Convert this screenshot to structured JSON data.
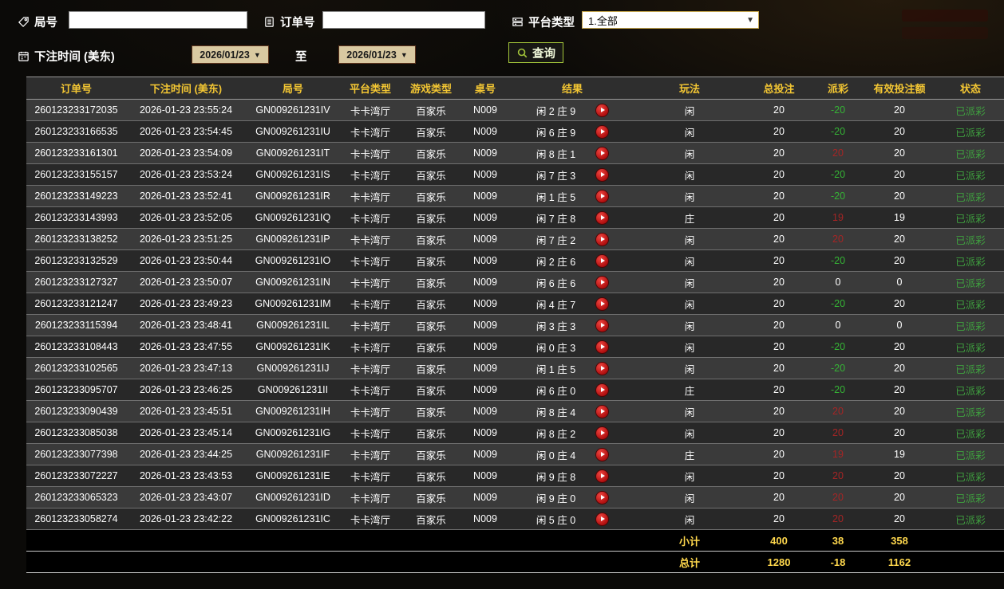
{
  "filters": {
    "round_label": "局号",
    "order_label": "订单号",
    "platform_label": "平台类型",
    "platform_value": "1.全部",
    "bet_time_label": "下注时间 (美东)",
    "date_from": "2026/01/23",
    "date_to": "2026/01/23",
    "to_label": "至",
    "query_label": "查询",
    "round_value": "",
    "order_value": ""
  },
  "icons": {
    "round": "tag-icon",
    "order": "clipboard-icon",
    "platform": "list-icon",
    "bet_time": "calendar-icon",
    "query": "search-icon",
    "replay": "play-icon",
    "dropdown": "chevron-down-icon"
  },
  "colors": {
    "header_yellow": "#f3c633",
    "summary_yellow": "#ffd84d",
    "win_red": "#a52525",
    "loss_green": "#35b435",
    "status_green": "#3fa03f",
    "query_border_green": "#a3c53a",
    "date_button_tan": "#d9c9a1"
  },
  "table": {
    "headers": [
      "订单号",
      "下注时间 (美东)",
      "局号",
      "平台类型",
      "游戏类型",
      "桌号",
      "结果",
      "玩法",
      "总投注",
      "派彩",
      "有效投注额",
      "状态"
    ],
    "rows": [
      {
        "order_id": "260123233172035",
        "bet_time": "2026-01-23 23:55:24",
        "round_id": "GN009261231IV",
        "platform": "卡卡湾厅",
        "game": "百家乐",
        "table_no": "N009",
        "result": "闲 2 庄 9",
        "play": "闲",
        "total_bet": "20",
        "payout": "-20",
        "valid_bet": "20",
        "status": "已派彩"
      },
      {
        "order_id": "260123233166535",
        "bet_time": "2026-01-23 23:54:45",
        "round_id": "GN009261231IU",
        "platform": "卡卡湾厅",
        "game": "百家乐",
        "table_no": "N009",
        "result": "闲 6 庄 9",
        "play": "闲",
        "total_bet": "20",
        "payout": "-20",
        "valid_bet": "20",
        "status": "已派彩"
      },
      {
        "order_id": "260123233161301",
        "bet_time": "2026-01-23 23:54:09",
        "round_id": "GN009261231IT",
        "platform": "卡卡湾厅",
        "game": "百家乐",
        "table_no": "N009",
        "result": "闲 8 庄 1",
        "play": "闲",
        "total_bet": "20",
        "payout": "20",
        "valid_bet": "20",
        "status": "已派彩"
      },
      {
        "order_id": "260123233155157",
        "bet_time": "2026-01-23 23:53:24",
        "round_id": "GN009261231IS",
        "platform": "卡卡湾厅",
        "game": "百家乐",
        "table_no": "N009",
        "result": "闲 7 庄 3",
        "play": "闲",
        "total_bet": "20",
        "payout": "-20",
        "valid_bet": "20",
        "status": "已派彩"
      },
      {
        "order_id": "260123233149223",
        "bet_time": "2026-01-23 23:52:41",
        "round_id": "GN009261231IR",
        "platform": "卡卡湾厅",
        "game": "百家乐",
        "table_no": "N009",
        "result": "闲 1 庄 5",
        "play": "闲",
        "total_bet": "20",
        "payout": "-20",
        "valid_bet": "20",
        "status": "已派彩"
      },
      {
        "order_id": "260123233143993",
        "bet_time": "2026-01-23 23:52:05",
        "round_id": "GN009261231IQ",
        "platform": "卡卡湾厅",
        "game": "百家乐",
        "table_no": "N009",
        "result": "闲 7 庄 8",
        "play": "庄",
        "total_bet": "20",
        "payout": "19",
        "valid_bet": "19",
        "status": "已派彩"
      },
      {
        "order_id": "260123233138252",
        "bet_time": "2026-01-23 23:51:25",
        "round_id": "GN009261231IP",
        "platform": "卡卡湾厅",
        "game": "百家乐",
        "table_no": "N009",
        "result": "闲 7 庄 2",
        "play": "闲",
        "total_bet": "20",
        "payout": "20",
        "valid_bet": "20",
        "status": "已派彩"
      },
      {
        "order_id": "260123233132529",
        "bet_time": "2026-01-23 23:50:44",
        "round_id": "GN009261231IO",
        "platform": "卡卡湾厅",
        "game": "百家乐",
        "table_no": "N009",
        "result": "闲 2 庄 6",
        "play": "闲",
        "total_bet": "20",
        "payout": "-20",
        "valid_bet": "20",
        "status": "已派彩"
      },
      {
        "order_id": "260123233127327",
        "bet_time": "2026-01-23 23:50:07",
        "round_id": "GN009261231IN",
        "platform": "卡卡湾厅",
        "game": "百家乐",
        "table_no": "N009",
        "result": "闲 6 庄 6",
        "play": "闲",
        "total_bet": "20",
        "payout": "0",
        "valid_bet": "0",
        "status": "已派彩"
      },
      {
        "order_id": "260123233121247",
        "bet_time": "2026-01-23 23:49:23",
        "round_id": "GN009261231IM",
        "platform": "卡卡湾厅",
        "game": "百家乐",
        "table_no": "N009",
        "result": "闲 4 庄 7",
        "play": "闲",
        "total_bet": "20",
        "payout": "-20",
        "valid_bet": "20",
        "status": "已派彩"
      },
      {
        "order_id": "260123233115394",
        "bet_time": "2026-01-23 23:48:41",
        "round_id": "GN009261231IL",
        "platform": "卡卡湾厅",
        "game": "百家乐",
        "table_no": "N009",
        "result": "闲 3 庄 3",
        "play": "闲",
        "total_bet": "20",
        "payout": "0",
        "valid_bet": "0",
        "status": "已派彩"
      },
      {
        "order_id": "260123233108443",
        "bet_time": "2026-01-23 23:47:55",
        "round_id": "GN009261231IK",
        "platform": "卡卡湾厅",
        "game": "百家乐",
        "table_no": "N009",
        "result": "闲 0 庄 3",
        "play": "闲",
        "total_bet": "20",
        "payout": "-20",
        "valid_bet": "20",
        "status": "已派彩"
      },
      {
        "order_id": "260123233102565",
        "bet_time": "2026-01-23 23:47:13",
        "round_id": "GN009261231IJ",
        "platform": "卡卡湾厅",
        "game": "百家乐",
        "table_no": "N009",
        "result": "闲 1 庄 5",
        "play": "闲",
        "total_bet": "20",
        "payout": "-20",
        "valid_bet": "20",
        "status": "已派彩"
      },
      {
        "order_id": "260123233095707",
        "bet_time": "2026-01-23 23:46:25",
        "round_id": "GN009261231II",
        "platform": "卡卡湾厅",
        "game": "百家乐",
        "table_no": "N009",
        "result": "闲 6 庄 0",
        "play": "庄",
        "total_bet": "20",
        "payout": "-20",
        "valid_bet": "20",
        "status": "已派彩"
      },
      {
        "order_id": "260123233090439",
        "bet_time": "2026-01-23 23:45:51",
        "round_id": "GN009261231IH",
        "platform": "卡卡湾厅",
        "game": "百家乐",
        "table_no": "N009",
        "result": "闲 8 庄 4",
        "play": "闲",
        "total_bet": "20",
        "payout": "20",
        "valid_bet": "20",
        "status": "已派彩"
      },
      {
        "order_id": "260123233085038",
        "bet_time": "2026-01-23 23:45:14",
        "round_id": "GN009261231IG",
        "platform": "卡卡湾厅",
        "game": "百家乐",
        "table_no": "N009",
        "result": "闲 8 庄 2",
        "play": "闲",
        "total_bet": "20",
        "payout": "20",
        "valid_bet": "20",
        "status": "已派彩"
      },
      {
        "order_id": "260123233077398",
        "bet_time": "2026-01-23 23:44:25",
        "round_id": "GN009261231IF",
        "platform": "卡卡湾厅",
        "game": "百家乐",
        "table_no": "N009",
        "result": "闲 0 庄 4",
        "play": "庄",
        "total_bet": "20",
        "payout": "19",
        "valid_bet": "19",
        "status": "已派彩"
      },
      {
        "order_id": "260123233072227",
        "bet_time": "2026-01-23 23:43:53",
        "round_id": "GN009261231IE",
        "platform": "卡卡湾厅",
        "game": "百家乐",
        "table_no": "N009",
        "result": "闲 9 庄 8",
        "play": "闲",
        "total_bet": "20",
        "payout": "20",
        "valid_bet": "20",
        "status": "已派彩"
      },
      {
        "order_id": "260123233065323",
        "bet_time": "2026-01-23 23:43:07",
        "round_id": "GN009261231ID",
        "platform": "卡卡湾厅",
        "game": "百家乐",
        "table_no": "N009",
        "result": "闲 9 庄 0",
        "play": "闲",
        "total_bet": "20",
        "payout": "20",
        "valid_bet": "20",
        "status": "已派彩"
      },
      {
        "order_id": "260123233058274",
        "bet_time": "2026-01-23 23:42:22",
        "round_id": "GN009261231IC",
        "platform": "卡卡湾厅",
        "game": "百家乐",
        "table_no": "N009",
        "result": "闲 5 庄 0",
        "play": "闲",
        "total_bet": "20",
        "payout": "20",
        "valid_bet": "20",
        "status": "已派彩"
      }
    ],
    "subtotal": {
      "label": "小计",
      "total_bet": "400",
      "payout": "38",
      "valid_bet": "358"
    },
    "total": {
      "label": "总计",
      "total_bet": "1280",
      "payout": "-18",
      "valid_bet": "1162"
    }
  }
}
